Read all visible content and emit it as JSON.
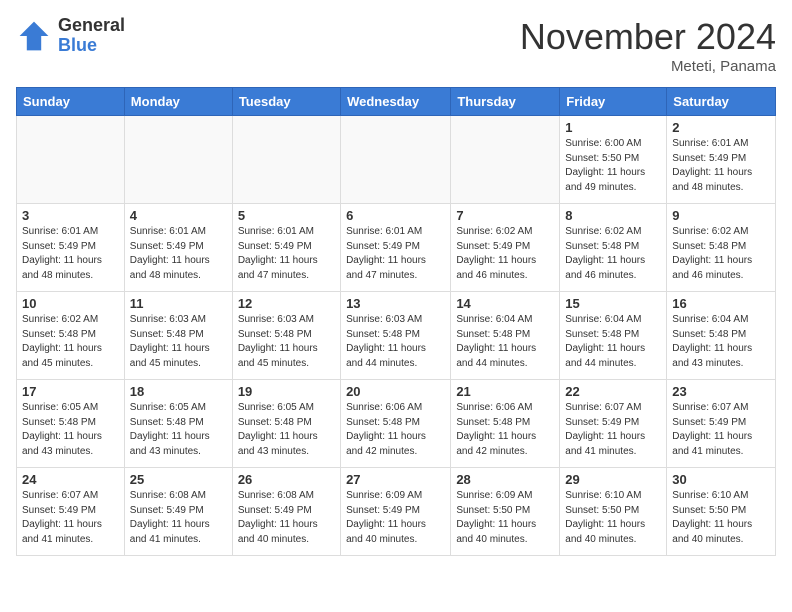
{
  "logo": {
    "general": "General",
    "blue": "Blue"
  },
  "title": "November 2024",
  "location": "Meteti, Panama",
  "days": [
    "Sunday",
    "Monday",
    "Tuesday",
    "Wednesday",
    "Thursday",
    "Friday",
    "Saturday"
  ],
  "weeks": [
    [
      {
        "day": "",
        "content": ""
      },
      {
        "day": "",
        "content": ""
      },
      {
        "day": "",
        "content": ""
      },
      {
        "day": "",
        "content": ""
      },
      {
        "day": "",
        "content": ""
      },
      {
        "day": "1",
        "content": "Sunrise: 6:00 AM\nSunset: 5:50 PM\nDaylight: 11 hours and 49 minutes."
      },
      {
        "day": "2",
        "content": "Sunrise: 6:01 AM\nSunset: 5:49 PM\nDaylight: 11 hours and 48 minutes."
      }
    ],
    [
      {
        "day": "3",
        "content": "Sunrise: 6:01 AM\nSunset: 5:49 PM\nDaylight: 11 hours and 48 minutes."
      },
      {
        "day": "4",
        "content": "Sunrise: 6:01 AM\nSunset: 5:49 PM\nDaylight: 11 hours and 48 minutes."
      },
      {
        "day": "5",
        "content": "Sunrise: 6:01 AM\nSunset: 5:49 PM\nDaylight: 11 hours and 47 minutes."
      },
      {
        "day": "6",
        "content": "Sunrise: 6:01 AM\nSunset: 5:49 PM\nDaylight: 11 hours and 47 minutes."
      },
      {
        "day": "7",
        "content": "Sunrise: 6:02 AM\nSunset: 5:49 PM\nDaylight: 11 hours and 46 minutes."
      },
      {
        "day": "8",
        "content": "Sunrise: 6:02 AM\nSunset: 5:48 PM\nDaylight: 11 hours and 46 minutes."
      },
      {
        "day": "9",
        "content": "Sunrise: 6:02 AM\nSunset: 5:48 PM\nDaylight: 11 hours and 46 minutes."
      }
    ],
    [
      {
        "day": "10",
        "content": "Sunrise: 6:02 AM\nSunset: 5:48 PM\nDaylight: 11 hours and 45 minutes."
      },
      {
        "day": "11",
        "content": "Sunrise: 6:03 AM\nSunset: 5:48 PM\nDaylight: 11 hours and 45 minutes."
      },
      {
        "day": "12",
        "content": "Sunrise: 6:03 AM\nSunset: 5:48 PM\nDaylight: 11 hours and 45 minutes."
      },
      {
        "day": "13",
        "content": "Sunrise: 6:03 AM\nSunset: 5:48 PM\nDaylight: 11 hours and 44 minutes."
      },
      {
        "day": "14",
        "content": "Sunrise: 6:04 AM\nSunset: 5:48 PM\nDaylight: 11 hours and 44 minutes."
      },
      {
        "day": "15",
        "content": "Sunrise: 6:04 AM\nSunset: 5:48 PM\nDaylight: 11 hours and 44 minutes."
      },
      {
        "day": "16",
        "content": "Sunrise: 6:04 AM\nSunset: 5:48 PM\nDaylight: 11 hours and 43 minutes."
      }
    ],
    [
      {
        "day": "17",
        "content": "Sunrise: 6:05 AM\nSunset: 5:48 PM\nDaylight: 11 hours and 43 minutes."
      },
      {
        "day": "18",
        "content": "Sunrise: 6:05 AM\nSunset: 5:48 PM\nDaylight: 11 hours and 43 minutes."
      },
      {
        "day": "19",
        "content": "Sunrise: 6:05 AM\nSunset: 5:48 PM\nDaylight: 11 hours and 43 minutes."
      },
      {
        "day": "20",
        "content": "Sunrise: 6:06 AM\nSunset: 5:48 PM\nDaylight: 11 hours and 42 minutes."
      },
      {
        "day": "21",
        "content": "Sunrise: 6:06 AM\nSunset: 5:48 PM\nDaylight: 11 hours and 42 minutes."
      },
      {
        "day": "22",
        "content": "Sunrise: 6:07 AM\nSunset: 5:49 PM\nDaylight: 11 hours and 41 minutes."
      },
      {
        "day": "23",
        "content": "Sunrise: 6:07 AM\nSunset: 5:49 PM\nDaylight: 11 hours and 41 minutes."
      }
    ],
    [
      {
        "day": "24",
        "content": "Sunrise: 6:07 AM\nSunset: 5:49 PM\nDaylight: 11 hours and 41 minutes."
      },
      {
        "day": "25",
        "content": "Sunrise: 6:08 AM\nSunset: 5:49 PM\nDaylight: 11 hours and 41 minutes."
      },
      {
        "day": "26",
        "content": "Sunrise: 6:08 AM\nSunset: 5:49 PM\nDaylight: 11 hours and 40 minutes."
      },
      {
        "day": "27",
        "content": "Sunrise: 6:09 AM\nSunset: 5:49 PM\nDaylight: 11 hours and 40 minutes."
      },
      {
        "day": "28",
        "content": "Sunrise: 6:09 AM\nSunset: 5:50 PM\nDaylight: 11 hours and 40 minutes."
      },
      {
        "day": "29",
        "content": "Sunrise: 6:10 AM\nSunset: 5:50 PM\nDaylight: 11 hours and 40 minutes."
      },
      {
        "day": "30",
        "content": "Sunrise: 6:10 AM\nSunset: 5:50 PM\nDaylight: 11 hours and 40 minutes."
      }
    ]
  ]
}
